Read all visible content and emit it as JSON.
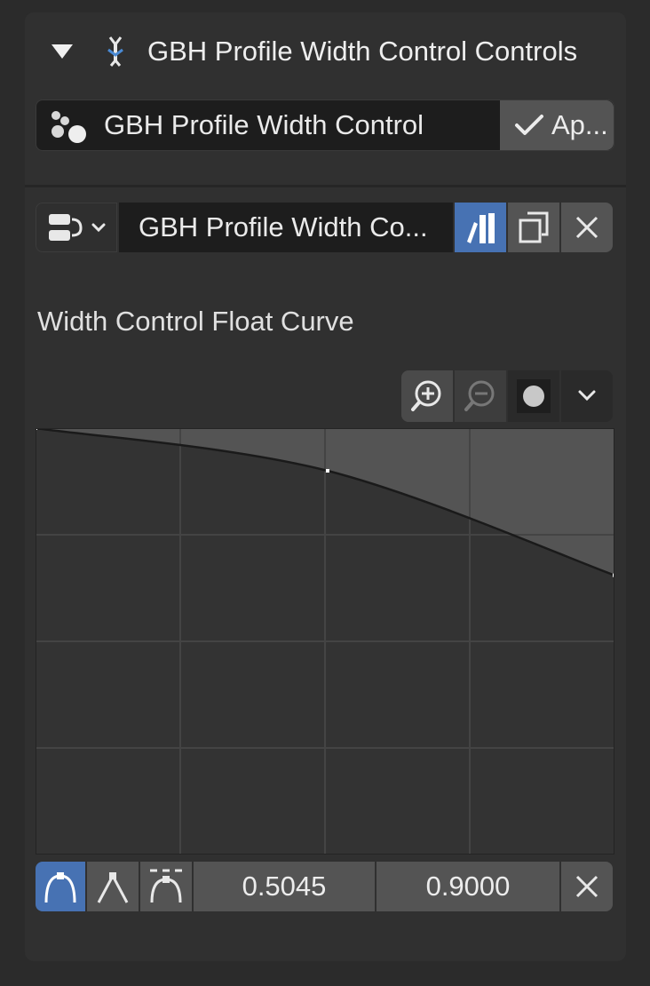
{
  "header": {
    "title": "GBH Profile Width Control Controls",
    "collapse_icon": "disclosure-triangle-down",
    "modifier_icon": "geometry-nodes-modifier-icon"
  },
  "modifier_row": {
    "label": "GBH Profile Width Control",
    "icon": "modifier-dots-icon",
    "apply_label": "Ap..."
  },
  "node_group_row": {
    "name": "GBH Profile Width Co...",
    "fake_user_active": true
  },
  "curve": {
    "label": "Width Control Float Curve",
    "grid_columns": 4,
    "grid_rows": 4,
    "points": [
      {
        "x": 0.0,
        "y": 1.0
      },
      {
        "x": 0.5045,
        "y": 0.9
      },
      {
        "x": 1.0,
        "y": 0.655
      }
    ]
  },
  "selected_point": {
    "x_value": "0.5045",
    "y_value": "0.9000"
  },
  "colors": {
    "accent": "#4772b3",
    "panel": "#303030",
    "button": "#545454",
    "field": "#1d1d1d"
  }
}
